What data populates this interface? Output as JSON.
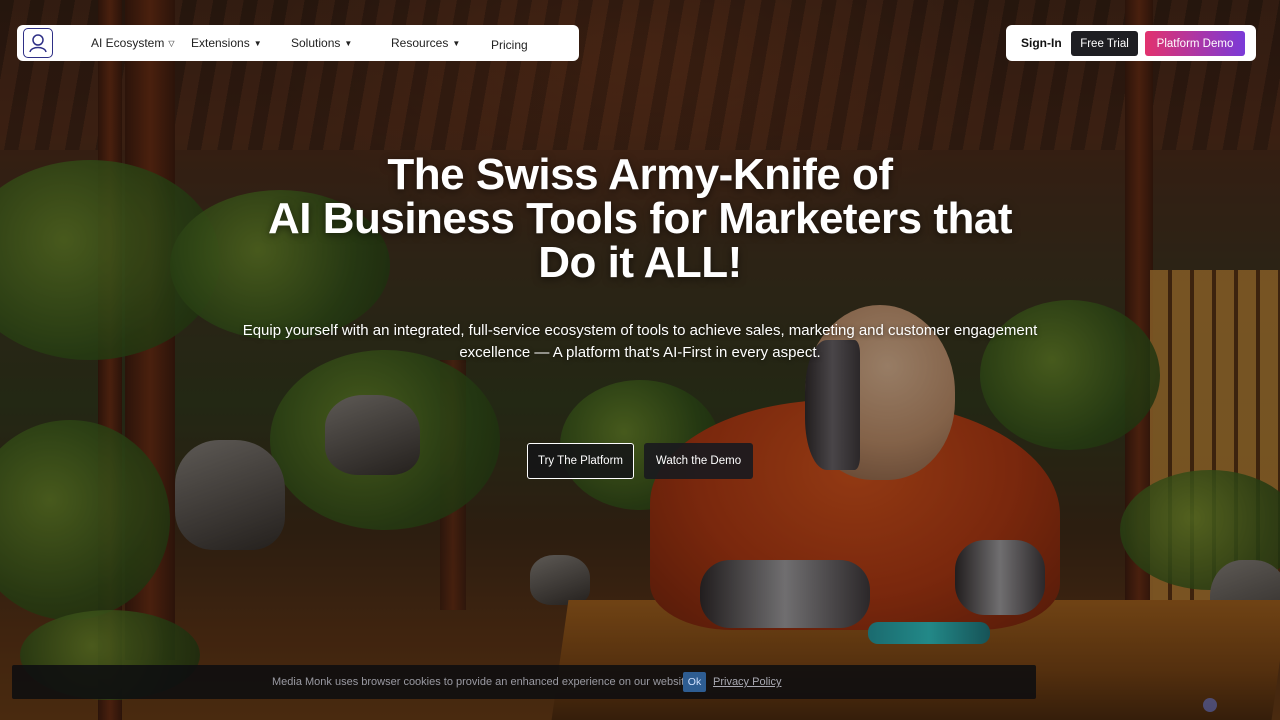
{
  "nav": {
    "items": [
      {
        "label": "AI Ecosystem",
        "caret": "▽"
      },
      {
        "label": "Extensions",
        "caret": "▼"
      },
      {
        "label": "Solutions",
        "caret": "▼"
      },
      {
        "label": "Resources",
        "caret": "▼"
      },
      {
        "label": "Pricing"
      }
    ],
    "sign_in": "Sign-In",
    "free_trial": "Free Trial",
    "platform_demo": "Platform Demo"
  },
  "hero": {
    "title_lines": [
      "The Swiss Army-Knife of",
      "AI Business Tools for Marketers that",
      "Do it ALL!"
    ],
    "subtitle_line1": "Equip yourself with an integrated, full-service ecosystem of tools to achieve sales, marketing and customer engagement",
    "subtitle_line2": "excellence — A platform that's AI-First in every aspect.",
    "cta_try": "Try The Platform",
    "cta_watch": "Watch the Demo"
  },
  "cookie": {
    "text": "Media Monk uses browser cookies to provide an enhanced experience on our website.",
    "ok": "Ok",
    "policy_link": "Privacy Policy"
  },
  "colors": {
    "demo_gradient_start": "#e2326e",
    "demo_gradient_end": "#7a3ad8",
    "logo_stroke": "#2e2f86"
  }
}
